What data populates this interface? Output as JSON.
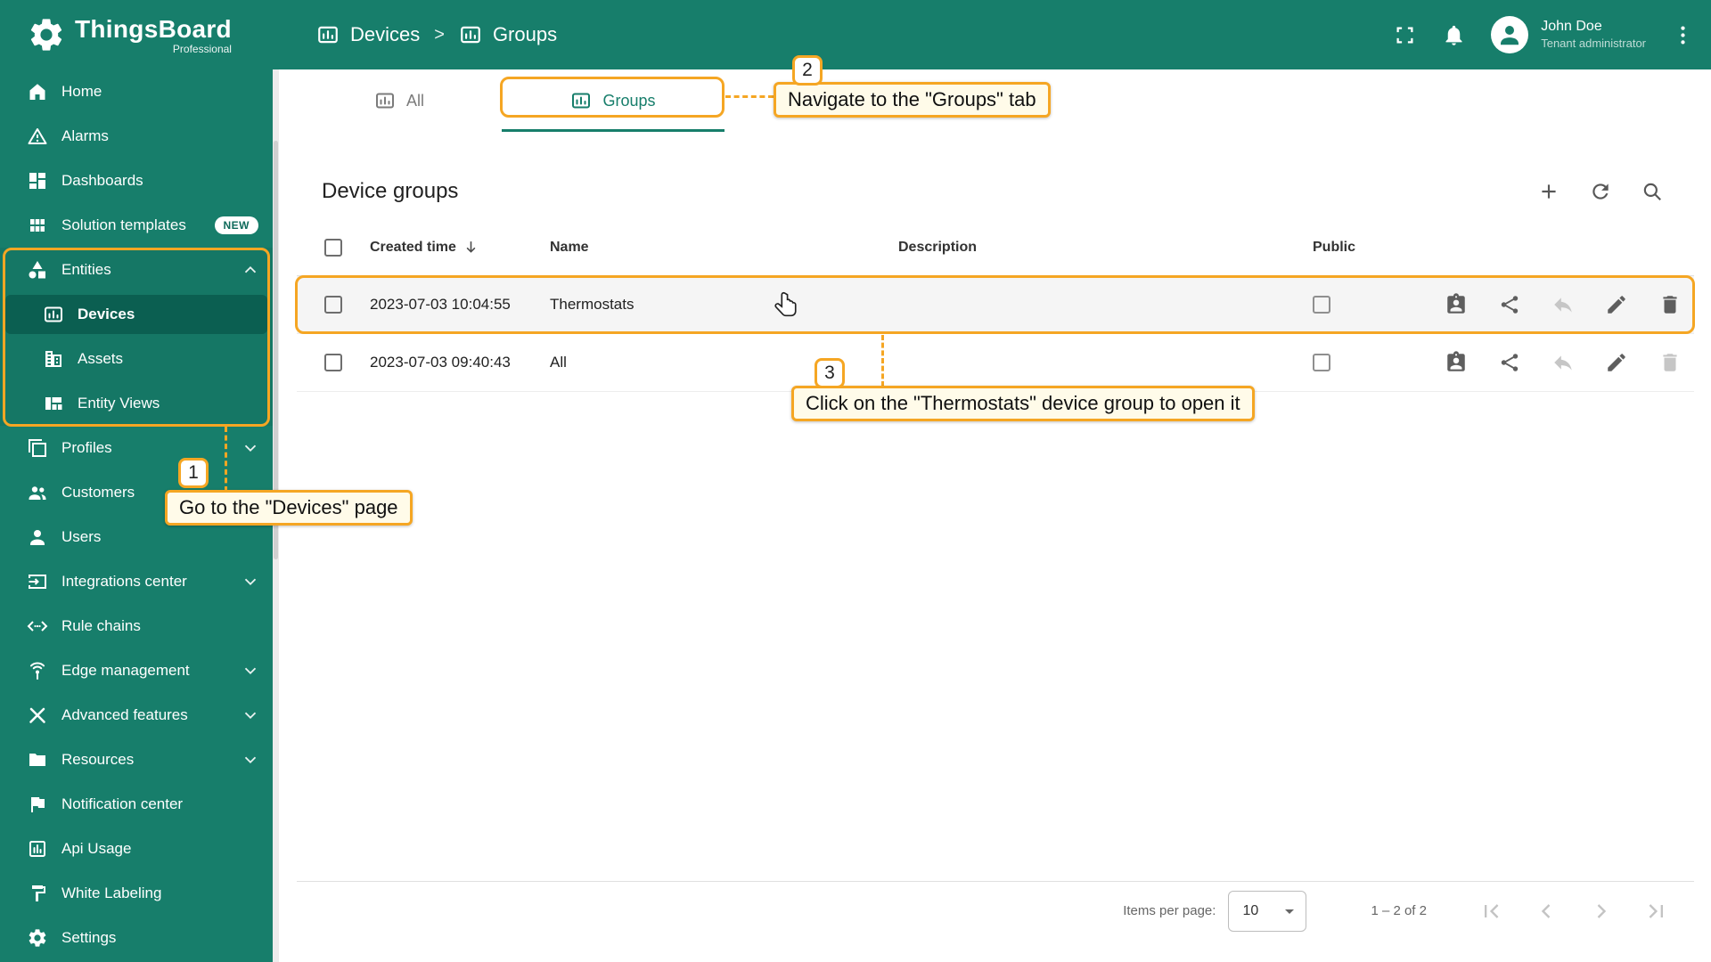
{
  "app": {
    "name": "ThingsBoard",
    "edition": "Professional"
  },
  "colors": {
    "primary": "#177e6b",
    "primary_dark": "#0b5f51",
    "accent": "#f5a623",
    "annotation_bg": "#fffbe9"
  },
  "header": {
    "breadcrumb": {
      "item1": "Devices",
      "separator": ">",
      "item2": "Groups"
    },
    "user": {
      "name": "John Doe",
      "role": "Tenant administrator"
    }
  },
  "sidebar": {
    "items": [
      {
        "label": "Home"
      },
      {
        "label": "Alarms"
      },
      {
        "label": "Dashboards"
      },
      {
        "label": "Solution templates",
        "badge": "NEW"
      },
      {
        "label": "Entities"
      },
      {
        "label": "Devices"
      },
      {
        "label": "Assets"
      },
      {
        "label": "Entity Views"
      },
      {
        "label": "Profiles"
      },
      {
        "label": "Customers"
      },
      {
        "label": "Users"
      },
      {
        "label": "Integrations center"
      },
      {
        "label": "Rule chains"
      },
      {
        "label": "Edge management"
      },
      {
        "label": "Advanced features"
      },
      {
        "label": "Resources"
      },
      {
        "label": "Notification center"
      },
      {
        "label": "Api Usage"
      },
      {
        "label": "White Labeling"
      },
      {
        "label": "Settings"
      }
    ]
  },
  "tabs": {
    "all": "All",
    "groups": "Groups"
  },
  "table": {
    "title": "Device groups",
    "columns": {
      "created": "Created time",
      "name": "Name",
      "description": "Description",
      "public": "Public"
    },
    "rows": [
      {
        "created": "2023-07-03 10:04:55",
        "name": "Thermostats",
        "description": "",
        "public": false
      },
      {
        "created": "2023-07-03 09:40:43",
        "name": "All",
        "description": "",
        "public": false
      }
    ]
  },
  "row_actions": [
    "assignment",
    "share",
    "reply",
    "edit",
    "delete"
  ],
  "pagination": {
    "label": "Items per page:",
    "per_page": "10",
    "range": "1 – 2 of 2"
  },
  "annotations": {
    "step1": {
      "num": "1",
      "text": "Go to the \"Devices\" page"
    },
    "step2": {
      "num": "2",
      "text": "Navigate to the \"Groups\" tab"
    },
    "step3": {
      "num": "3",
      "text": "Click on the \"Thermostats\" device group to open it"
    }
  },
  "icons": {
    "logo": "gear",
    "breadcrumb": "device-group",
    "header_right": [
      "fullscreen",
      "notifications-bell",
      "account-avatar",
      "more-vertical"
    ],
    "table_toolbar": [
      "add-plus",
      "refresh",
      "search"
    ],
    "cursor": "hand-pointer"
  }
}
